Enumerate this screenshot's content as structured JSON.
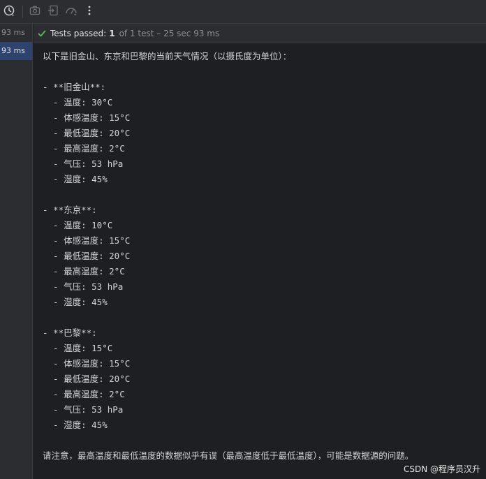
{
  "toolbar": {
    "icons": [
      "history-icon",
      "camera-icon",
      "export-icon",
      "dashboard-icon",
      "more-icon"
    ]
  },
  "gutter": {
    "rows": [
      "93 ms",
      "93 ms"
    ]
  },
  "status": {
    "label": "Tests passed:",
    "count": "1",
    "rest": "of 1 test – 25 sec 93 ms"
  },
  "console": {
    "lines": [
      "以下是旧金山、东京和巴黎的当前天气情况（以摄氏度为单位）：",
      "",
      "- **旧金山**:",
      "  - 温度: 30°C",
      "  - 体感温度: 15°C",
      "  - 最低温度: 20°C",
      "  - 最高温度: 2°C",
      "  - 气压: 53 hPa",
      "  - 湿度: 45%",
      "",
      "- **东京**:",
      "  - 温度: 10°C",
      "  - 体感温度: 15°C",
      "  - 最低温度: 20°C",
      "  - 最高温度: 2°C",
      "  - 气压: 53 hPa",
      "  - 湿度: 45%",
      "",
      "- **巴黎**:",
      "  - 温度: 15°C",
      "  - 体感温度: 15°C",
      "  - 最低温度: 20°C",
      "  - 最高温度: 2°C",
      "  - 气压: 53 hPa",
      "  - 湿度: 45%",
      "",
      "请注意，最高温度和最低温度的数据似乎有误（最高温度低于最低温度），可能是数据源的问题。"
    ]
  },
  "watermark": "CSDN @程序员汉升",
  "colors": {
    "background": "#1e1f22",
    "panel": "#2b2d30",
    "selected_row": "#2e436e",
    "success": "#5fb865",
    "muted_text": "#8c8f94"
  }
}
